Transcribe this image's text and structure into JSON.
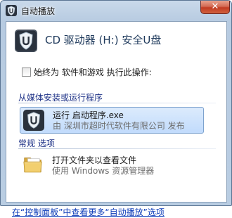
{
  "window": {
    "title": "自动播放",
    "close_glyph": "✕"
  },
  "drive": {
    "title": "CD 驱动器 (H:) 安全U盘"
  },
  "always": {
    "label": "始终为 软件和游戏 执行此操作:",
    "checked": false
  },
  "media_section": {
    "header": "从媒体安装或运行程序",
    "item": {
      "title": "运行 启动程序.exe",
      "subtitle": "由 深圳市超时代软件有限公司 发布",
      "selected": true
    }
  },
  "general_section": {
    "header": "常规 选项",
    "item": {
      "title": "打开文件夹以查看文件",
      "subtitle": "使用 Windows 资源管理器"
    }
  },
  "footer": {
    "link": "在“控制面板”中查看更多“自动播放”选项"
  },
  "colors": {
    "link": "#0c3bb8",
    "section_header": "#1e3287",
    "selection_border": "#7da2ce",
    "close_button": "#c23b22"
  },
  "icons": {
    "app": "autoplay-shield-icon",
    "drive": "secure-usb-shield-icon",
    "program": "secure-usb-shield-icon",
    "folder": "folder-icon",
    "close": "close-icon"
  }
}
